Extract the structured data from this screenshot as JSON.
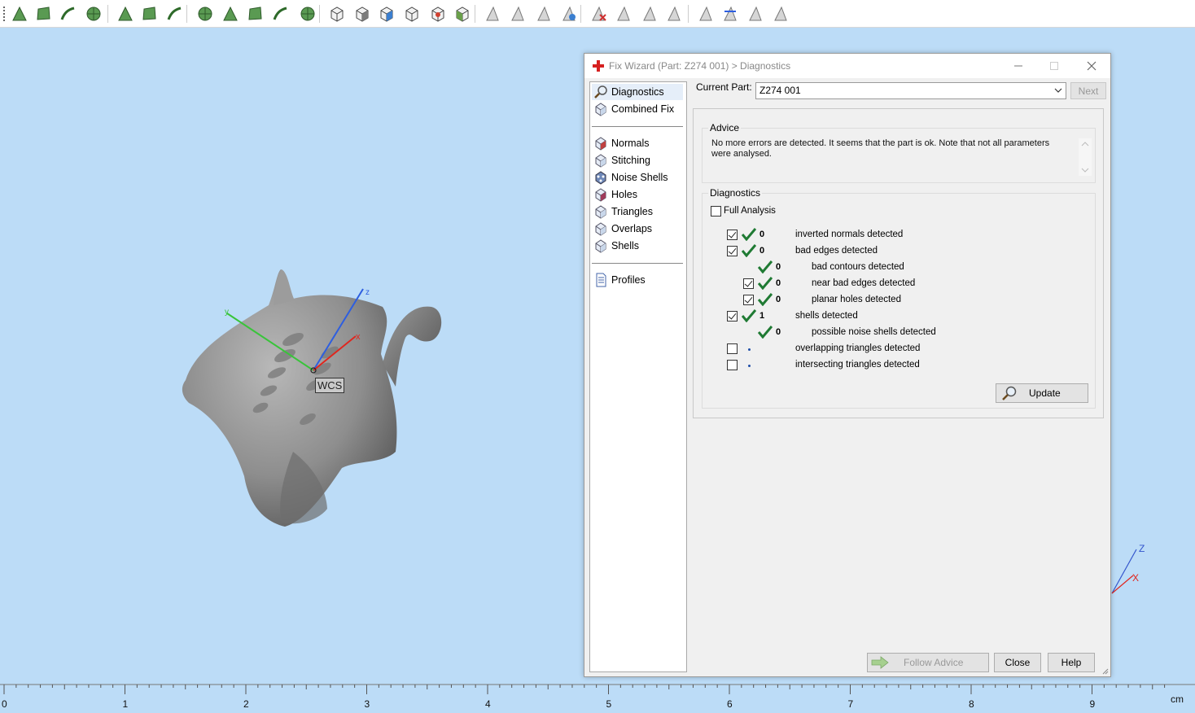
{
  "toolbar": {
    "icons": [
      "mark-triangle-icon",
      "mark-surface-icon",
      "mark-shell-icon",
      "mark-plane-icon",
      "mark-rectangle-icon",
      "mark-connected-icon",
      "mark-curve-icon",
      "mark-area-icon",
      "mark-brush-icon",
      "mark-wave-icon",
      "mark-segment-icon",
      "mark-fan-icon",
      "view-front-icon",
      "view-back-icon",
      "view-left-icon",
      "view-right-icon",
      "view-top-icon",
      "view-bottom-icon",
      "unmark-icon",
      "unmark-surface-icon",
      "unmark-shell-icon",
      "invert-mark-icon",
      "delete-marked-icon",
      "cut-triangles-icon",
      "copy-triangles-icon",
      "extrude-icon",
      "mark-light-icon",
      "mark-settings-icon",
      "mark-filter-icon",
      "mark-options-icon"
    ]
  },
  "viewport": {
    "wcs_label": "WCS",
    "axis_x": "x",
    "axis_y": "y",
    "axis_z": "z",
    "corner_axis_z": "Z",
    "corner_axis_x": "X"
  },
  "ruler": {
    "labels": [
      "0",
      "1",
      "2",
      "3",
      "4",
      "5",
      "6",
      "7",
      "8",
      "9"
    ],
    "unit": "cm"
  },
  "dialog": {
    "title": "Fix Wizard (Part: Z274 001) > Diagnostics",
    "nav": {
      "items": [
        {
          "label": "Diagnostics",
          "icon": "magnifier-icon",
          "selected": true
        },
        {
          "label": "Combined Fix",
          "icon": "combined-fix-icon",
          "selected": false
        },
        {
          "label": "Normals",
          "icon": "normals-cube-icon",
          "selected": false
        },
        {
          "label": "Stitching",
          "icon": "stitching-cube-icon",
          "selected": false
        },
        {
          "label": "Noise Shells",
          "icon": "noise-shells-icon",
          "selected": false
        },
        {
          "label": "Holes",
          "icon": "holes-cube-icon",
          "selected": false
        },
        {
          "label": "Triangles",
          "icon": "triangles-cube-icon",
          "selected": false
        },
        {
          "label": "Overlaps",
          "icon": "overlaps-cube-icon",
          "selected": false
        },
        {
          "label": "Shells",
          "icon": "shells-cube-icon",
          "selected": false
        },
        {
          "label": "Profiles",
          "icon": "profiles-document-icon",
          "selected": false
        }
      ]
    },
    "current_part_label": "Current Part:",
    "current_part_value": "Z274 001",
    "next_label": "Next",
    "advice": {
      "title": "Advice",
      "text": "No more errors are detected. It seems that the part is ok. Note that not all parameters were analysed."
    },
    "diagnostics": {
      "title": "Diagnostics",
      "full_analysis_label": "Full Analysis",
      "full_analysis_checked": false,
      "rows": [
        {
          "checkbox": true,
          "checked": true,
          "status": "ok",
          "count": "0",
          "label": "inverted normals detected",
          "indent": 0
        },
        {
          "checkbox": true,
          "checked": true,
          "status": "ok",
          "count": "0",
          "label": "bad edges detected",
          "indent": 0
        },
        {
          "checkbox": false,
          "checked": false,
          "status": "ok",
          "count": "0",
          "label": "bad contours detected",
          "indent": 1
        },
        {
          "checkbox": true,
          "checked": true,
          "status": "ok",
          "count": "0",
          "label": "near bad edges detected",
          "indent": 1
        },
        {
          "checkbox": true,
          "checked": true,
          "status": "ok",
          "count": "0",
          "label": "planar holes detected",
          "indent": 1
        },
        {
          "checkbox": true,
          "checked": true,
          "status": "ok",
          "count": "1",
          "label": "shells detected",
          "indent": 0
        },
        {
          "checkbox": false,
          "checked": false,
          "status": "ok",
          "count": "0",
          "label": "possible noise shells detected",
          "indent": 1
        },
        {
          "checkbox": true,
          "checked": false,
          "status": "pending",
          "count": "",
          "label": "overlapping triangles detected",
          "indent": 0
        },
        {
          "checkbox": true,
          "checked": false,
          "status": "pending",
          "count": "",
          "label": "intersecting triangles detected",
          "indent": 0
        }
      ],
      "update_label": "Update"
    },
    "buttons": {
      "follow_advice": "Follow Advice",
      "close": "Close",
      "help": "Help"
    },
    "colors": {
      "accent_check": "#1f7a33",
      "title_icon": "#d62020",
      "viewport_bg": "#bcdcf7"
    }
  }
}
